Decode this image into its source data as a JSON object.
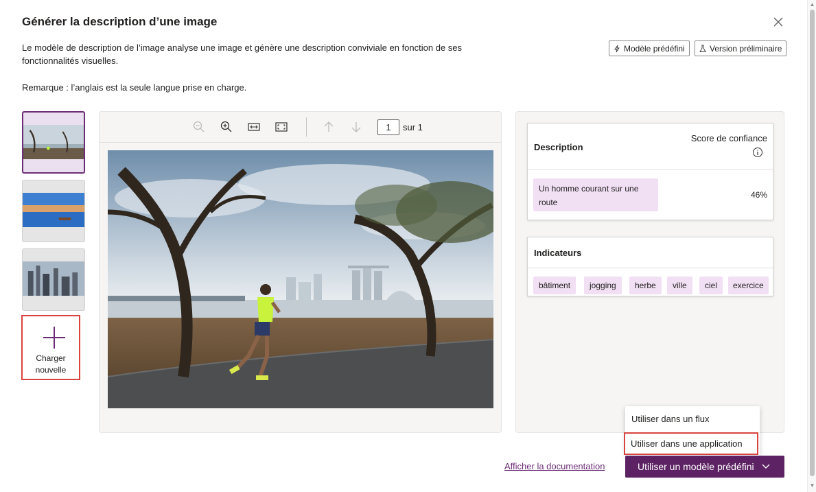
{
  "dialog": {
    "title": "Générer la description d’une image",
    "description": "Le modèle de description de l’image analyse une image et génère une description conviviale en fonction de ses fonctionnalités visuelles.",
    "note": "Remarque : l’anglais est la seule langue prise en charge.",
    "badges": {
      "prebuilt": "Modèle prédéfini",
      "preview": "Version préliminaire"
    }
  },
  "thumbnails": {
    "upload_label": "Charger nouvelle"
  },
  "viewer": {
    "page_number": "1",
    "page_of": "sur 1"
  },
  "results": {
    "description_header": "Description",
    "confidence_header": "Score de confiance",
    "caption": "Un homme courant sur une route",
    "confidence": "46%",
    "tags_header": "Indicateurs",
    "tags": [
      "bâtiment",
      "jogging",
      "herbe",
      "ville",
      "ciel",
      "exercice"
    ]
  },
  "footer": {
    "doc_link": "Afficher la documentation",
    "primary_button": "Utiliser un modèle prédéfini",
    "menu": [
      "Utiliser dans un flux",
      "Utiliser dans une application"
    ]
  },
  "colors": {
    "accent": "#5c2263",
    "tag_bg": "#f1dff4",
    "highlight": "#d9433e"
  }
}
